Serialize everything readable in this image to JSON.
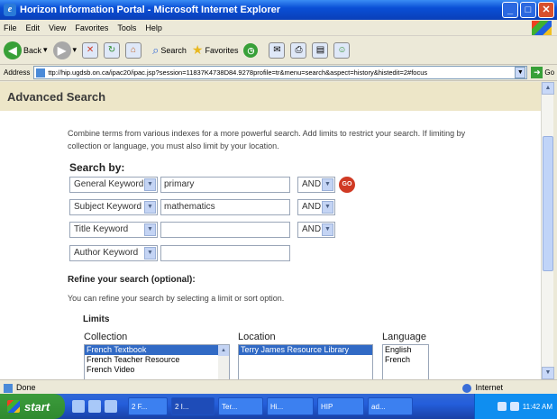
{
  "window": {
    "title": "Horizon Information Portal - Microsoft Internet Explorer"
  },
  "menu": [
    "File",
    "Edit",
    "View",
    "Favorites",
    "Tools",
    "Help"
  ],
  "toolbar": {
    "back_label": "Back",
    "search_label": "Search",
    "favorites_label": "Favorites"
  },
  "address": {
    "label": "Address",
    "url": "ttp://hip.ugdsb.on.ca/ipac20/ipac.jsp?session=11837K4738D84.9278profile=tr&menu=search&aspect=history&histedit=2#focus",
    "go_label": "Go"
  },
  "page": {
    "heading": "Advanced Search",
    "intro": "Combine terms from various indexes for a more powerful search. Add limits to restrict your search. If limiting by collection or language, you must also limit by your location.",
    "search_by_label": "Search by:",
    "rows": [
      {
        "index": "General Keyword",
        "term": "primary",
        "op": "AND"
      },
      {
        "index": "Subject Keyword",
        "term": "mathematics",
        "op": "AND"
      },
      {
        "index": "Title Keyword",
        "term": "",
        "op": "AND"
      },
      {
        "index": "Author Keyword",
        "term": ""
      }
    ],
    "go_button": "GO",
    "refine_heading": "Refine your search (optional):",
    "refine_sub": "You can refine your search by selecting a limit or sort option.",
    "limits_label": "Limits",
    "collection_label": "Collection",
    "collection_options": [
      "French Textbook",
      "French Teacher Resource",
      "French Video"
    ],
    "location_label": "Location",
    "location_options": [
      "Terry James Resource Library"
    ],
    "language_label": "Language",
    "language_options": [
      "English",
      "French"
    ]
  },
  "status": {
    "left": "Done",
    "zone": "Internet"
  },
  "taskbar": {
    "start": "start",
    "tasks": [
      "2 F...",
      "2 I...",
      "Ter...",
      "Hi...",
      "HIP",
      "ad..."
    ],
    "clock": "11:42 AM"
  },
  "colors": {
    "title_blue": "#0a4fd6",
    "header_beige": "#ede6c8",
    "go_red": "#d03a24",
    "selection_blue": "#316ac5"
  }
}
